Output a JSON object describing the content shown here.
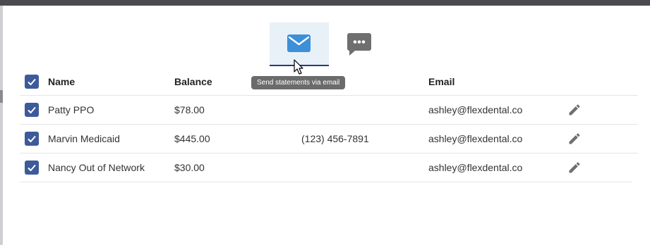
{
  "tabs": {
    "email": {
      "icon": "envelope-icon",
      "active": true
    },
    "text": {
      "icon": "chat-bubble-icon",
      "active": false
    }
  },
  "tooltip": {
    "text": "Send statements via email"
  },
  "table": {
    "headers": {
      "name": "Name",
      "balance": "Balance",
      "email": "Email"
    },
    "rows": [
      {
        "checked": true,
        "name": "Patty PPO",
        "balance": "$78.00",
        "phone": "",
        "email": "ashley@flexdental.co"
      },
      {
        "checked": true,
        "name": "Marvin Medicaid",
        "balance": "$445.00",
        "phone": "(123) 456-7891",
        "email": "ashley@flexdental.co"
      },
      {
        "checked": true,
        "name": "Nancy Out of Network",
        "balance": "$30.00",
        "phone": "",
        "email": "ashley@flexdental.co"
      }
    ]
  },
  "colors": {
    "accent": "#3d5a9b",
    "tab_active_bg": "#e8f0f8",
    "tab_underline": "#1f3d7a",
    "envelope": "#3d8fd8",
    "icon_gray": "#6f6f6f",
    "tooltip_bg": "#6b6b6b"
  }
}
